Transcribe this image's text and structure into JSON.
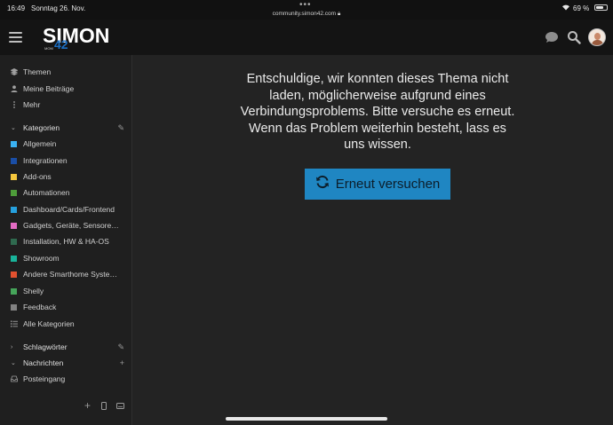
{
  "status_bar": {
    "time": "16:49",
    "date": "Sonntag 26. Nov.",
    "url": "community.simon42.com",
    "battery": "69 %"
  },
  "header": {
    "logo_text": "SIMON",
    "logo_number": "42",
    "logo_sub": "MOM",
    "icons": [
      "hamburger-icon",
      "chat-icon",
      "search-icon",
      "avatar"
    ]
  },
  "sidebar": {
    "top_items": [
      {
        "label": "Themen",
        "icon": "layers-icon"
      },
      {
        "label": "Meine Beiträge",
        "icon": "user-icon"
      },
      {
        "label": "Mehr",
        "icon": "more-vertical-icon"
      }
    ],
    "categories_header": "Kategorien",
    "categories": [
      {
        "label": "Allgemein",
        "color": "#3ab1f1"
      },
      {
        "label": "Integrationen",
        "color": "#1a4ea6"
      },
      {
        "label": "Add-ons",
        "color": "#f5c73d"
      },
      {
        "label": "Automationen",
        "color": "#4e9d3a"
      },
      {
        "label": "Dashboard/Cards/Frontend",
        "color": "#26a0dd"
      },
      {
        "label": "Gadgets, Geräte, Sensore…",
        "color": "#e46cc4"
      },
      {
        "label": "Installation, HW & HA-OS",
        "color": "#2f6a4f"
      },
      {
        "label": "Showroom",
        "color": "#19b39a"
      },
      {
        "label": "Andere Smarthome Syste…",
        "color": "#e2512f"
      },
      {
        "label": "Shelly",
        "color": "#46a55a"
      },
      {
        "label": "Feedback",
        "color": "#828282"
      }
    ],
    "all_categories": "Alle Kategorien",
    "tags_header": "Schlagwörter",
    "messages_header": "Nachrichten",
    "inbox": "Posteingang"
  },
  "main": {
    "error_message": "Entschuldige, wir konnten dieses Thema nicht laden, möglicherweise aufgrund eines Verbindungsproblems. Bitte versuche es erneut. Wenn das Problem weiterhin besteht, lass es uns wissen.",
    "retry_label": "Erneut versuchen"
  }
}
